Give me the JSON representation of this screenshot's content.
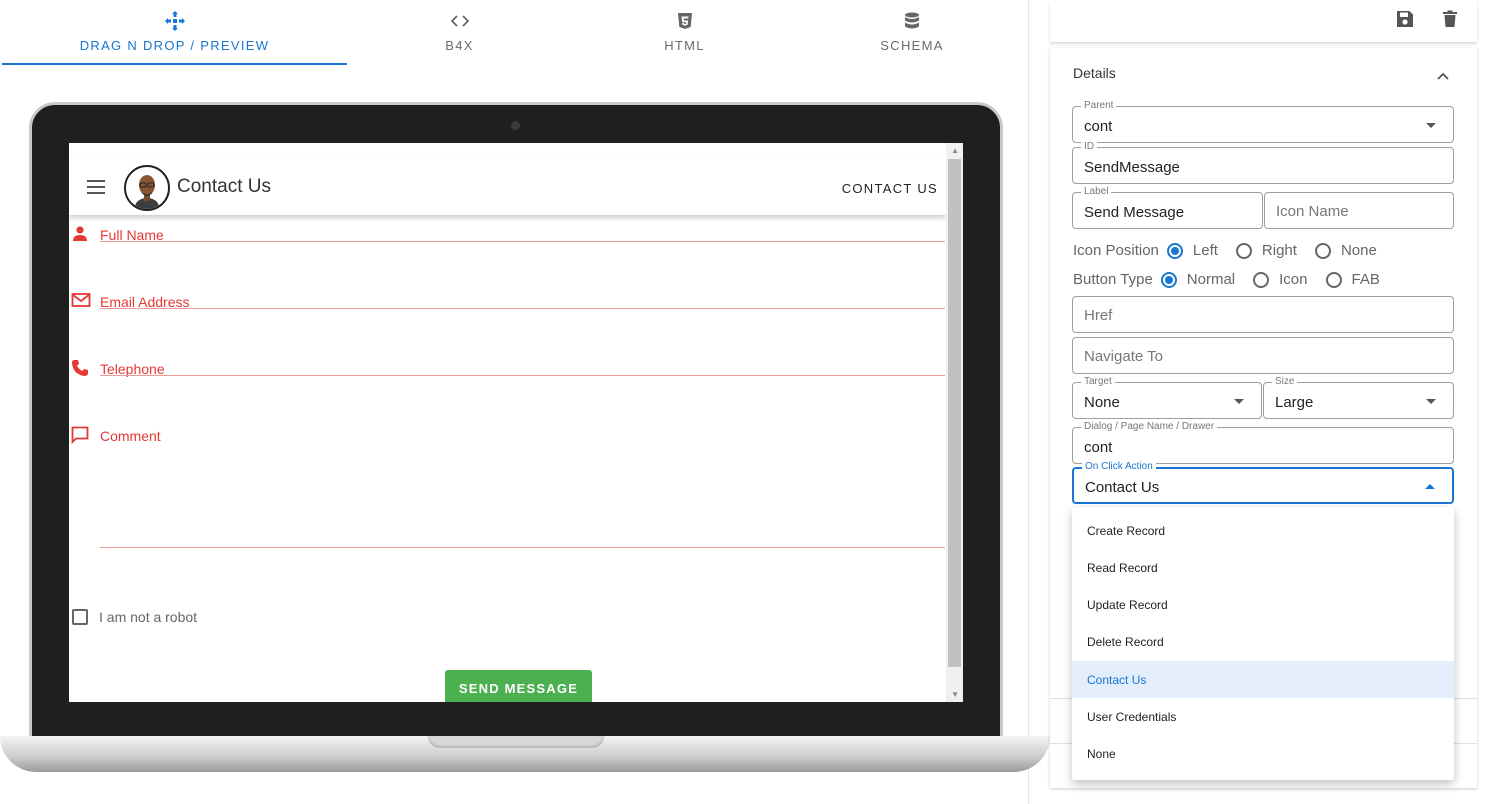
{
  "tabs": [
    {
      "label": "DRAG N DROP / PREVIEW",
      "icon": "drag-drop-icon",
      "active": true
    },
    {
      "label": "B4X",
      "icon": "code-icon",
      "active": false
    },
    {
      "label": "HTML",
      "icon": "html5-icon",
      "active": false
    },
    {
      "label": "SCHEMA",
      "icon": "database-icon",
      "active": false
    }
  ],
  "preview": {
    "app_title": "Contact Us",
    "app_action": "CONTACT US",
    "fields": [
      {
        "label": "Full Name",
        "icon": "person-icon"
      },
      {
        "label": "Email Address",
        "icon": "email-icon"
      },
      {
        "label": "Telephone",
        "icon": "phone-icon"
      },
      {
        "label": "Comment",
        "icon": "comment-icon"
      }
    ],
    "checkbox_label": "I am not a robot",
    "send_button": "SEND MESSAGE"
  },
  "panel": {
    "details_title": "Details",
    "parent": {
      "legend": "Parent",
      "value": "cont"
    },
    "id": {
      "legend": "ID",
      "value": "SendMessage"
    },
    "label": {
      "legend": "Label",
      "value": "Send Message"
    },
    "icon_name": {
      "placeholder": "Icon Name"
    },
    "icon_position": {
      "label": "Icon Position",
      "options": [
        "Left",
        "Right",
        "None"
      ],
      "selected": "Left"
    },
    "button_type": {
      "label": "Button Type",
      "options": [
        "Normal",
        "Icon",
        "FAB"
      ],
      "selected": "Normal"
    },
    "href": {
      "placeholder": "Href"
    },
    "navigate_to": {
      "placeholder": "Navigate To"
    },
    "target": {
      "legend": "Target",
      "value": "None"
    },
    "size": {
      "legend": "Size",
      "value": "Large"
    },
    "dialog_page": {
      "legend": "Dialog / Page Name / Drawer",
      "value": "cont"
    },
    "on_click": {
      "legend": "On Click Action",
      "value": "Contact Us"
    },
    "menu_options": [
      "Create Record",
      "Read Record",
      "Update Record",
      "Delete Record",
      "Contact Us",
      "User Credentials",
      "None"
    ],
    "menu_selected": "Contact Us"
  },
  "colors": {
    "accent": "#1976d2",
    "error": "#e53935",
    "success": "#4caf50"
  }
}
